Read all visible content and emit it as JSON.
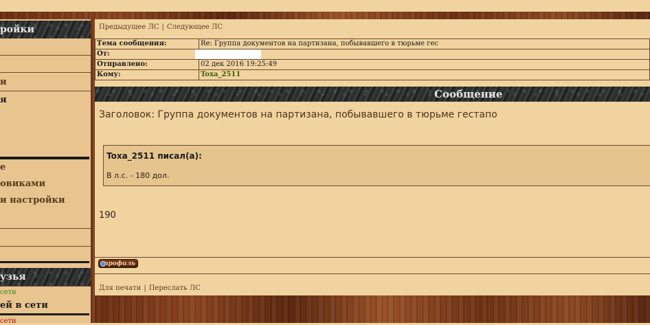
{
  "sidebar": {
    "settings_header": "ройки",
    "items": [
      {
        "label": "и"
      },
      {
        "label": "я"
      },
      {
        "label": "е"
      },
      {
        "label": "овиками"
      },
      {
        "label": "и настройки"
      }
    ],
    "friends_header": "узья",
    "friends_status": [
      {
        "label": "сети"
      },
      {
        "label": "ей в сети"
      },
      {
        "label": "сети"
      }
    ]
  },
  "pm_nav": {
    "previous": "Предыдущее ЛС",
    "separator": "|",
    "next": "Следующее ЛС"
  },
  "header_fields": [
    {
      "label": "Тема сообщения:",
      "value": "Re: Группа документов на партизана, побывавшего в тюрьме гес"
    },
    {
      "label": "От:",
      "value": ""
    },
    {
      "label": "Отправлено:",
      "value": "02 дек 2016 19:25:49"
    },
    {
      "label": "Кому:",
      "value": "Toxa_2511"
    }
  ],
  "message": {
    "section_title": "Сообщение",
    "subject_line": "Заголовок: Группа документов на партизана, побывавшего в тюрьме гестапо",
    "quote_author": "Toxa_2511 писал(а):",
    "quote_text": "В л.с. - 180 дол.",
    "reply_text": "190"
  },
  "profile_button": {
    "label": "профиль",
    "icon": "profile-globe-icon"
  },
  "bottom_nav": {
    "print": "Для печати",
    "separator": "|",
    "forward": "Переслать ЛС"
  },
  "colors": {
    "background": "#f1d3a0",
    "sidebar_bg": "#e8c48e",
    "quote_bg": "#e6c48e",
    "recipient": "#3a5a0a",
    "friends_online": "#2a8a1a",
    "friends_offline": "#c01010"
  }
}
